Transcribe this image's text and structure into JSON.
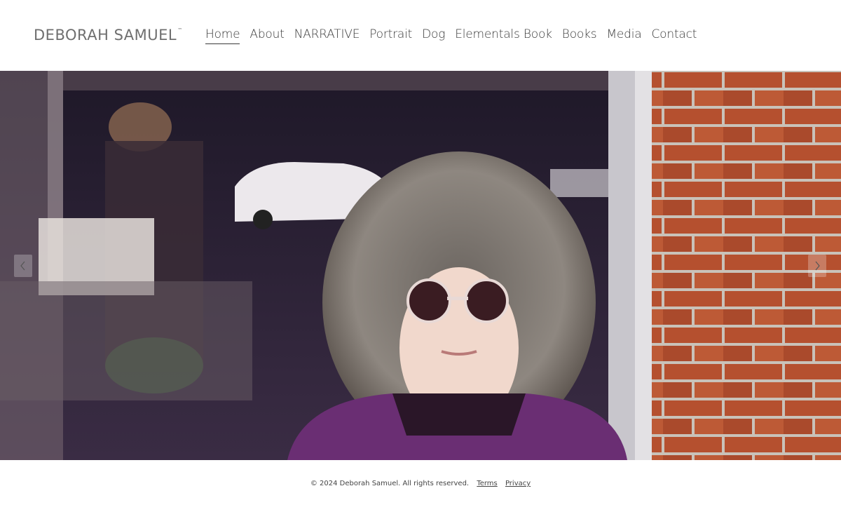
{
  "header": {
    "logo": "DEBORAH SAMUEL",
    "logo_mark": "™",
    "nav": [
      {
        "label": "Home",
        "active": true
      },
      {
        "label": "About"
      },
      {
        "label": "NARRATIVE"
      },
      {
        "label": "Portrait"
      },
      {
        "label": "Dog"
      },
      {
        "label": "Elementals Book"
      },
      {
        "label": "Books"
      },
      {
        "label": "Media"
      },
      {
        "label": "Contact"
      }
    ]
  },
  "slideshow": {
    "prev_icon": "chevron-left-icon",
    "next_icon": "chevron-right-icon"
  },
  "footer": {
    "copyright": "© 2024 Deborah Samuel. All rights reserved.",
    "terms": "Terms",
    "privacy": "Privacy"
  },
  "colors": {
    "brick": "#b24a2e",
    "jacket": "#6a2e73",
    "window_dark": "#2b2236"
  }
}
